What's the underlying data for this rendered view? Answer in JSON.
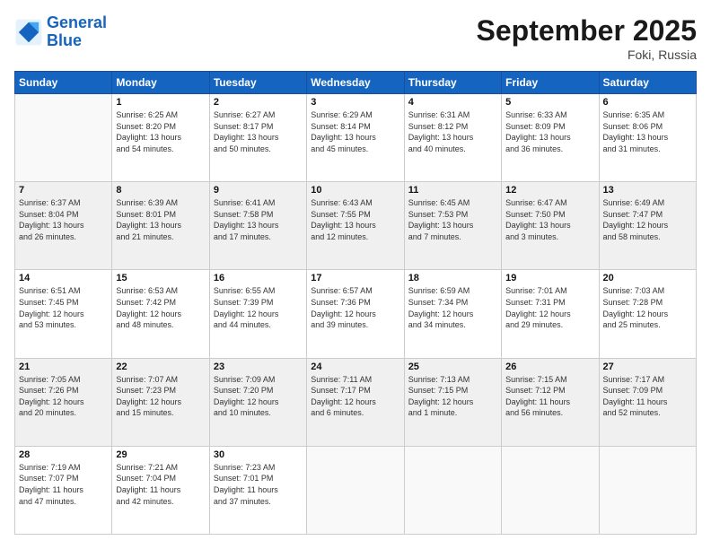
{
  "logo": {
    "line1": "General",
    "line2": "Blue"
  },
  "header": {
    "month": "September 2025",
    "location": "Foki, Russia"
  },
  "weekdays": [
    "Sunday",
    "Monday",
    "Tuesday",
    "Wednesday",
    "Thursday",
    "Friday",
    "Saturday"
  ],
  "weeks": [
    [
      {
        "day": "",
        "info": ""
      },
      {
        "day": "1",
        "info": "Sunrise: 6:25 AM\nSunset: 8:20 PM\nDaylight: 13 hours\nand 54 minutes."
      },
      {
        "day": "2",
        "info": "Sunrise: 6:27 AM\nSunset: 8:17 PM\nDaylight: 13 hours\nand 50 minutes."
      },
      {
        "day": "3",
        "info": "Sunrise: 6:29 AM\nSunset: 8:14 PM\nDaylight: 13 hours\nand 45 minutes."
      },
      {
        "day": "4",
        "info": "Sunrise: 6:31 AM\nSunset: 8:12 PM\nDaylight: 13 hours\nand 40 minutes."
      },
      {
        "day": "5",
        "info": "Sunrise: 6:33 AM\nSunset: 8:09 PM\nDaylight: 13 hours\nand 36 minutes."
      },
      {
        "day": "6",
        "info": "Sunrise: 6:35 AM\nSunset: 8:06 PM\nDaylight: 13 hours\nand 31 minutes."
      }
    ],
    [
      {
        "day": "7",
        "info": "Sunrise: 6:37 AM\nSunset: 8:04 PM\nDaylight: 13 hours\nand 26 minutes."
      },
      {
        "day": "8",
        "info": "Sunrise: 6:39 AM\nSunset: 8:01 PM\nDaylight: 13 hours\nand 21 minutes."
      },
      {
        "day": "9",
        "info": "Sunrise: 6:41 AM\nSunset: 7:58 PM\nDaylight: 13 hours\nand 17 minutes."
      },
      {
        "day": "10",
        "info": "Sunrise: 6:43 AM\nSunset: 7:55 PM\nDaylight: 13 hours\nand 12 minutes."
      },
      {
        "day": "11",
        "info": "Sunrise: 6:45 AM\nSunset: 7:53 PM\nDaylight: 13 hours\nand 7 minutes."
      },
      {
        "day": "12",
        "info": "Sunrise: 6:47 AM\nSunset: 7:50 PM\nDaylight: 13 hours\nand 3 minutes."
      },
      {
        "day": "13",
        "info": "Sunrise: 6:49 AM\nSunset: 7:47 PM\nDaylight: 12 hours\nand 58 minutes."
      }
    ],
    [
      {
        "day": "14",
        "info": "Sunrise: 6:51 AM\nSunset: 7:45 PM\nDaylight: 12 hours\nand 53 minutes."
      },
      {
        "day": "15",
        "info": "Sunrise: 6:53 AM\nSunset: 7:42 PM\nDaylight: 12 hours\nand 48 minutes."
      },
      {
        "day": "16",
        "info": "Sunrise: 6:55 AM\nSunset: 7:39 PM\nDaylight: 12 hours\nand 44 minutes."
      },
      {
        "day": "17",
        "info": "Sunrise: 6:57 AM\nSunset: 7:36 PM\nDaylight: 12 hours\nand 39 minutes."
      },
      {
        "day": "18",
        "info": "Sunrise: 6:59 AM\nSunset: 7:34 PM\nDaylight: 12 hours\nand 34 minutes."
      },
      {
        "day": "19",
        "info": "Sunrise: 7:01 AM\nSunset: 7:31 PM\nDaylight: 12 hours\nand 29 minutes."
      },
      {
        "day": "20",
        "info": "Sunrise: 7:03 AM\nSunset: 7:28 PM\nDaylight: 12 hours\nand 25 minutes."
      }
    ],
    [
      {
        "day": "21",
        "info": "Sunrise: 7:05 AM\nSunset: 7:26 PM\nDaylight: 12 hours\nand 20 minutes."
      },
      {
        "day": "22",
        "info": "Sunrise: 7:07 AM\nSunset: 7:23 PM\nDaylight: 12 hours\nand 15 minutes."
      },
      {
        "day": "23",
        "info": "Sunrise: 7:09 AM\nSunset: 7:20 PM\nDaylight: 12 hours\nand 10 minutes."
      },
      {
        "day": "24",
        "info": "Sunrise: 7:11 AM\nSunset: 7:17 PM\nDaylight: 12 hours\nand 6 minutes."
      },
      {
        "day": "25",
        "info": "Sunrise: 7:13 AM\nSunset: 7:15 PM\nDaylight: 12 hours\nand 1 minute."
      },
      {
        "day": "26",
        "info": "Sunrise: 7:15 AM\nSunset: 7:12 PM\nDaylight: 11 hours\nand 56 minutes."
      },
      {
        "day": "27",
        "info": "Sunrise: 7:17 AM\nSunset: 7:09 PM\nDaylight: 11 hours\nand 52 minutes."
      }
    ],
    [
      {
        "day": "28",
        "info": "Sunrise: 7:19 AM\nSunset: 7:07 PM\nDaylight: 11 hours\nand 47 minutes."
      },
      {
        "day": "29",
        "info": "Sunrise: 7:21 AM\nSunset: 7:04 PM\nDaylight: 11 hours\nand 42 minutes."
      },
      {
        "day": "30",
        "info": "Sunrise: 7:23 AM\nSunset: 7:01 PM\nDaylight: 11 hours\nand 37 minutes."
      },
      {
        "day": "",
        "info": ""
      },
      {
        "day": "",
        "info": ""
      },
      {
        "day": "",
        "info": ""
      },
      {
        "day": "",
        "info": ""
      }
    ]
  ]
}
